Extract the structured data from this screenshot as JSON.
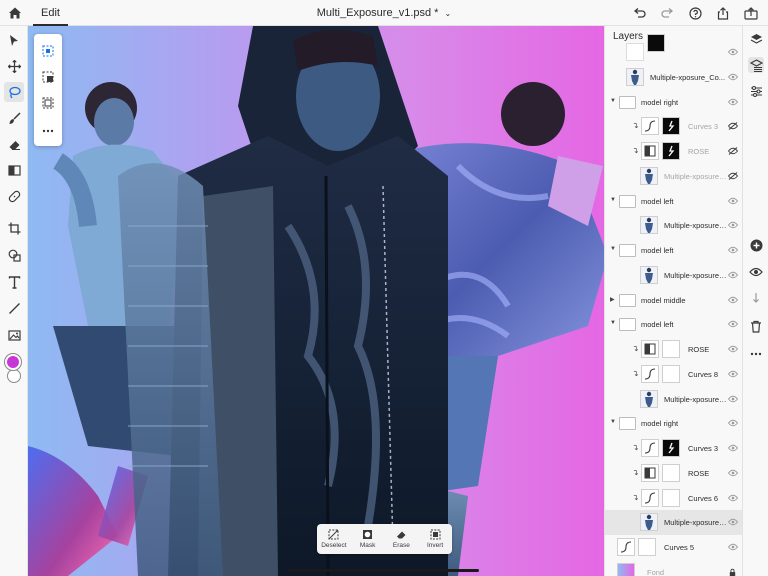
{
  "topbar": {
    "tab_label": "Edit",
    "document_title": "Multi_Exposure_v1.psd *",
    "icons": [
      "undo-icon",
      "redo-icon",
      "help-icon",
      "share-icon",
      "cloud-upload-icon"
    ]
  },
  "toolbar": {
    "tools": [
      "select-tool",
      "move-tool",
      "lasso-tool",
      "brush-tool",
      "eraser-tool",
      "gradient-tool",
      "healing-tool",
      "crop-tool",
      "shapes-tool",
      "type-tool",
      "line-tool",
      "image-tool"
    ],
    "active_tool": "lasso-tool",
    "foreground_color": "#c737d8",
    "background_color": "#ffffff"
  },
  "selection_panel": {
    "items": [
      "select-subject-icon",
      "select-add-icon",
      "select-subtract-icon",
      "more-icon"
    ]
  },
  "actionbar": {
    "actions": [
      {
        "label": "Deselect",
        "icon": "deselect-icon"
      },
      {
        "label": "Mask",
        "icon": "mask-icon"
      },
      {
        "label": "Erase",
        "icon": "erase-icon"
      },
      {
        "label": "Invert",
        "icon": "invert-icon"
      }
    ]
  },
  "layers": {
    "title": "Layers",
    "rows": [
      {
        "name": "",
        "kind": "partial",
        "indent": 0,
        "visible": true
      },
      {
        "name": "Multiple-xposure_Co...",
        "kind": "image",
        "indent": 0,
        "visible": true
      },
      {
        "name": "model right",
        "kind": "group",
        "indent": 0,
        "expanded": true,
        "visible": true
      },
      {
        "name": "Curves 3",
        "kind": "adjust-curves",
        "indent": 1,
        "clipped": true,
        "dim": true,
        "visible": false,
        "mask": "black"
      },
      {
        "name": "ROSE",
        "kind": "adjust-bw",
        "indent": 1,
        "clipped": true,
        "dim": true,
        "visible": false,
        "mask": "black"
      },
      {
        "name": "Multiple-xposure_Co...",
        "kind": "image",
        "indent": 1,
        "dim": true,
        "visible": false
      },
      {
        "name": "model left",
        "kind": "group",
        "indent": 0,
        "expanded": true,
        "visible": true
      },
      {
        "name": "Multiple-xposure_Co...",
        "kind": "image",
        "indent": 1,
        "visible": true
      },
      {
        "name": "model left",
        "kind": "group",
        "indent": 0,
        "expanded": true,
        "visible": true
      },
      {
        "name": "Multiple-xposure_Co...",
        "kind": "image",
        "indent": 1,
        "visible": true
      },
      {
        "name": "model middle",
        "kind": "group",
        "indent": 0,
        "expanded": false,
        "visible": true
      },
      {
        "name": "model left",
        "kind": "group",
        "indent": 0,
        "expanded": true,
        "visible": true
      },
      {
        "name": "ROSE",
        "kind": "adjust-bw",
        "indent": 1,
        "clipped": true,
        "visible": true,
        "mask": "white"
      },
      {
        "name": "Curves 8",
        "kind": "adjust-curves",
        "indent": 1,
        "clipped": true,
        "visible": true,
        "mask": "white"
      },
      {
        "name": "Multiple-xposure_Co...",
        "kind": "image",
        "indent": 1,
        "visible": true
      },
      {
        "name": "model right",
        "kind": "group",
        "indent": 0,
        "expanded": true,
        "visible": true
      },
      {
        "name": "Curves 3",
        "kind": "adjust-curves",
        "indent": 1,
        "clipped": true,
        "visible": true,
        "mask": "black"
      },
      {
        "name": "ROSE",
        "kind": "adjust-bw",
        "indent": 1,
        "clipped": true,
        "visible": true,
        "mask": "white"
      },
      {
        "name": "Curves 6",
        "kind": "adjust-curves",
        "indent": 1,
        "clipped": true,
        "visible": true,
        "mask": "white"
      },
      {
        "name": "Multiple-xposure_Co...",
        "kind": "image",
        "indent": 1,
        "visible": true,
        "selected": true
      },
      {
        "name": "Curves 5",
        "kind": "adjust-curves",
        "indent": 0,
        "visible": true,
        "mask": "white"
      },
      {
        "name": "Fond",
        "kind": "fill-gradient",
        "indent": 0,
        "dim": true,
        "locked": true
      }
    ]
  },
  "rail": {
    "icons": [
      "layers-icon",
      "layer-properties-icon",
      "adjustments-icon",
      "add-layer-icon",
      "visibility-icon",
      "arrange-icon",
      "delete-icon",
      "more-icon"
    ],
    "active": "layer-properties-icon"
  }
}
